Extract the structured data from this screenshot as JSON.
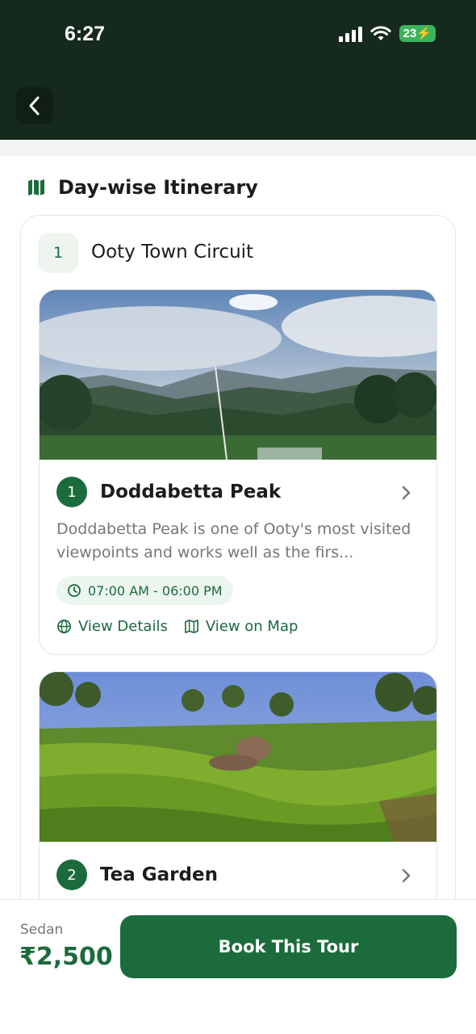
{
  "status_bar": {
    "time": "6:27",
    "battery": "23"
  },
  "header": {
    "back_icon": "chevron-left-icon"
  },
  "itinerary": {
    "title": "Day-wise Itinerary",
    "icon": "map-icon",
    "days": [
      {
        "number": "1",
        "title": "Ooty Town Circuit",
        "places": [
          {
            "index": "1",
            "name": "Doddabetta Peak",
            "description": "Doddabetta Peak is one of Ooty's most visited viewpoints and works well as the firs...",
            "hours": "07:00 AM - 06:00 PM",
            "view_details": "View Details",
            "view_on_map": "View on Map"
          },
          {
            "index": "2",
            "name": "Tea Garden"
          }
        ]
      }
    ]
  },
  "footer": {
    "vehicle": "Sedan",
    "price": "₹2,500",
    "book_label": "Book This Tour"
  },
  "colors": {
    "header_bg": "#15291c",
    "accent": "#1c6b3c",
    "pill_bg": "#edf6ee"
  }
}
